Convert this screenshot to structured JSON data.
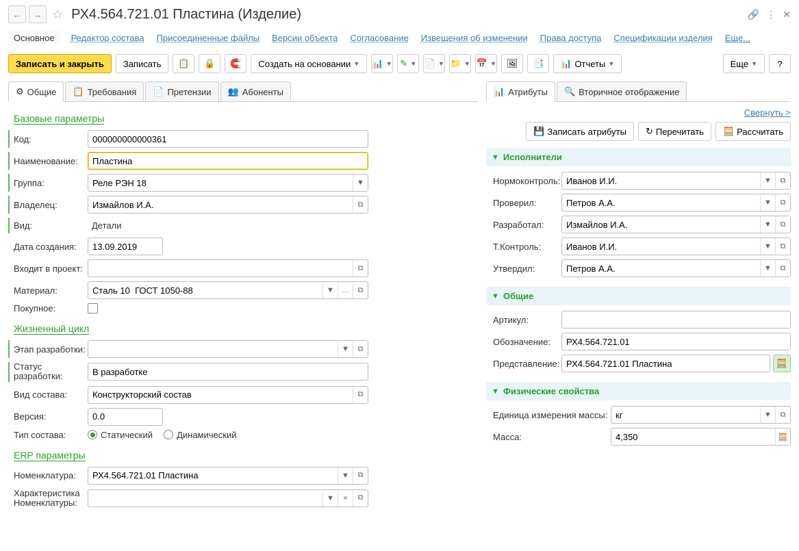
{
  "title": "РХ4.564.721.01 Пластина (Изделие)",
  "nav": [
    "Основное",
    "Редактор состава",
    "Присоединенные файлы",
    "Версии объекта",
    "Согласование",
    "Извещения об изменении",
    "Права доступа",
    "Спецификации изделия",
    "Еще..."
  ],
  "toolbar": {
    "saveClose": "Записать и закрыть",
    "save": "Записать",
    "createBase": "Создать на основании",
    "reports": "Отчеты",
    "more": "Еще"
  },
  "leftTabs": [
    "Общие",
    "Требования",
    "Претензии",
    "Абоненты"
  ],
  "rightTabs": [
    "Атрибуты",
    "Вторичное отображение"
  ],
  "collapse": "Свернуть >",
  "rightBtns": {
    "save": "Записать атрибуты",
    "reread": "Перечитать",
    "calc": "Рассчитать"
  },
  "sections": {
    "base": "Базовые параметры",
    "life": "Жизненный цикл",
    "erp": "ERP параметры",
    "performers": "Исполнители",
    "common": "Общие",
    "phys": "Физические свойства"
  },
  "base": {
    "code_l": "Код:",
    "code": "000000000000361",
    "name_l": "Наименование:",
    "name": "Пластина",
    "group_l": "Группа:",
    "group": "Реле РЭН 18",
    "owner_l": "Владелец:",
    "owner": "Измайлов И.А.",
    "kind_l": "Вид:",
    "kind": "Детали",
    "date_l": "Дата создания:",
    "date": "13.09.2019",
    "project_l": "Входит в проект:",
    "project": "",
    "material_l": "Материал:",
    "material": "Сталь 10  ГОСТ 1050-88",
    "purchased_l": "Покупное:"
  },
  "life": {
    "stage_l": "Этап разработки:",
    "stage": "",
    "status_l": "Статус разработки:",
    "status": "В разработке",
    "compType_l": "Вид состава:",
    "compType": "Конструкторский состав",
    "version_l": "Версия:",
    "version": "0.0",
    "compKind_l": "Тип состава:",
    "static": "Статический",
    "dynamic": "Динамический"
  },
  "erp": {
    "nomen_l": "Номенклатура:",
    "nomen": "РХ4.564.721.01 Пластина",
    "char_l": "Характеристика Номенклатуры:",
    "char": ""
  },
  "perf": {
    "norm_l": "Нормоконтроль:",
    "norm": "Иванов И.И.",
    "check_l": "Проверил:",
    "check": "Петров А.А.",
    "dev_l": "Разработал:",
    "dev": "Измайлов И.А.",
    "tctrl_l": "Т.Контроль:",
    "tctrl": "Иванов И.И.",
    "appr_l": "Утвердил:",
    "appr": "Петров А.А."
  },
  "common": {
    "art_l": "Артикул:",
    "art": "",
    "desig_l": "Обозначение:",
    "desig": "РХ4.564.721.01",
    "repr_l": "Представление:",
    "repr": "РХ4.564.721.01 Пластина"
  },
  "phys": {
    "unit_l": "Единица измерения массы:",
    "unit": "кг",
    "mass_l": "Масса:",
    "mass": "4,350"
  }
}
